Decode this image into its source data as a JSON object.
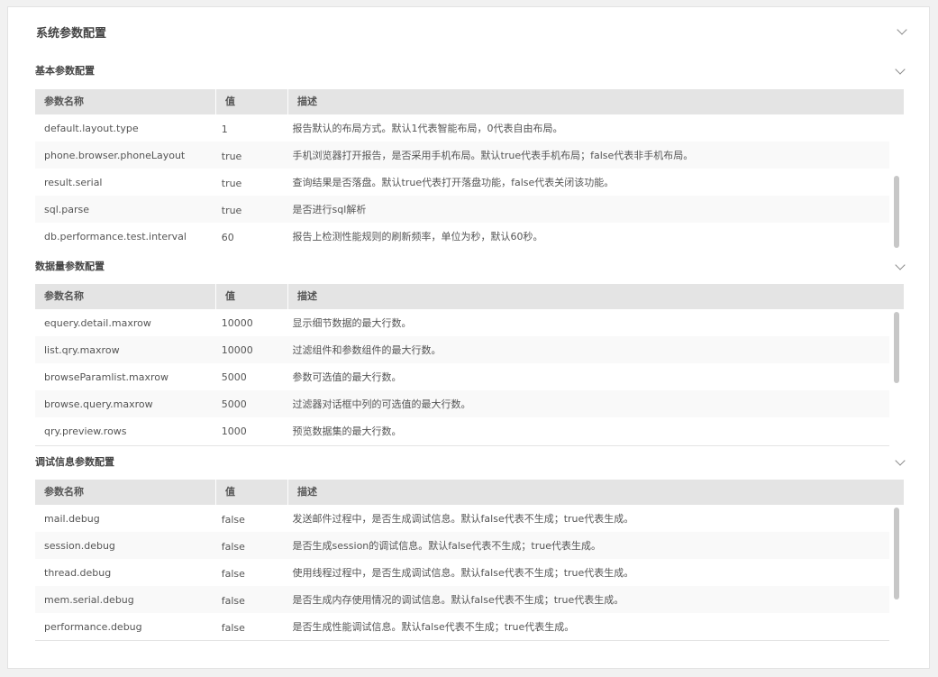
{
  "panel": {
    "title": "系统参数配置"
  },
  "columns": {
    "name": "参数名称",
    "value": "值",
    "desc": "描述"
  },
  "sections": [
    {
      "title": "基本参数配置",
      "rows": [
        {
          "name": "default.layout.type",
          "value": "1",
          "desc": "报告默认的布局方式。默认1代表智能布局，0代表自由布局。"
        },
        {
          "name": "phone.browser.phoneLayout",
          "value": "true",
          "desc": "手机浏览器打开报告，是否采用手机布局。默认true代表手机布局；false代表非手机布局。"
        },
        {
          "name": "result.serial",
          "value": "true",
          "desc": "查询结果是否落盘。默认true代表打开落盘功能，false代表关闭该功能。"
        },
        {
          "name": "sql.parse",
          "value": "true",
          "desc": "是否进行sql解析"
        },
        {
          "name": "db.performance.test.interval",
          "value": "60",
          "desc": "报告上检测性能规则的刷新频率，单位为秒，默认60秒。"
        }
      ]
    },
    {
      "title": "数据量参数配置",
      "rows": [
        {
          "name": "equery.detail.maxrow",
          "value": "10000",
          "desc": "显示细节数据的最大行数。"
        },
        {
          "name": "list.qry.maxrow",
          "value": "10000",
          "desc": "过滤组件和参数组件的最大行数。"
        },
        {
          "name": "browseParamlist.maxrow",
          "value": "5000",
          "desc": "参数可选值的最大行数。"
        },
        {
          "name": "browse.query.maxrow",
          "value": "5000",
          "desc": "过滤器对话框中列的可选值的最大行数。"
        },
        {
          "name": "qry.preview.rows",
          "value": "1000",
          "desc": "预览数据集的最大行数。"
        }
      ]
    },
    {
      "title": "调试信息参数配置",
      "rows": [
        {
          "name": "mail.debug",
          "value": "false",
          "desc": "发送邮件过程中，是否生成调试信息。默认false代表不生成；true代表生成。"
        },
        {
          "name": "session.debug",
          "value": "false",
          "desc": "是否生成session的调试信息。默认false代表不生成；true代表生成。"
        },
        {
          "name": "thread.debug",
          "value": "false",
          "desc": "使用线程过程中，是否生成调试信息。默认false代表不生成；true代表生成。"
        },
        {
          "name": "mem.serial.debug",
          "value": "false",
          "desc": "是否生成内存使用情况的调试信息。默认false代表不生成；true代表生成。"
        },
        {
          "name": "performance.debug",
          "value": "false",
          "desc": "是否生成性能调试信息。默认false代表不生成；true代表生成。"
        }
      ]
    }
  ]
}
